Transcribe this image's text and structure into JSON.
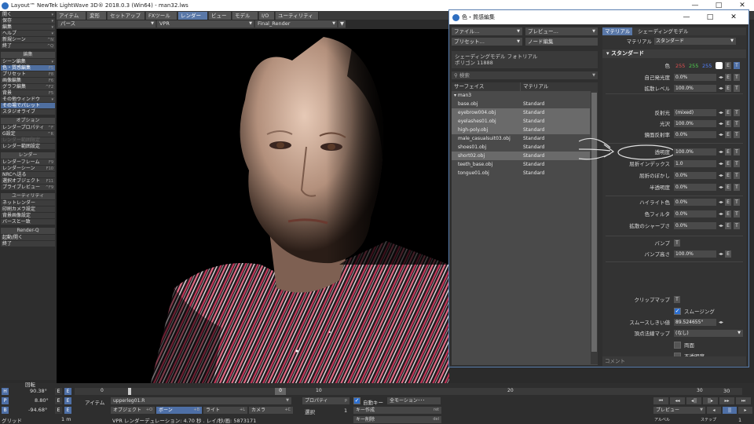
{
  "window": {
    "title": "Layout™ NewTek LightWave 3D® 2018.0.3 (Win64) - man32.lws",
    "controls": [
      "—",
      "□",
      "✕"
    ]
  },
  "menu_tabs": [
    {
      "label": "ファイル",
      "active": false
    },
    {
      "label": "アイテム",
      "active": false
    },
    {
      "label": "変形",
      "active": false
    },
    {
      "label": "セットアップ",
      "active": false
    },
    {
      "label": "FXツール",
      "active": false
    },
    {
      "label": "レンダー",
      "active": true
    },
    {
      "label": "ビュー",
      "active": false
    },
    {
      "label": "モデル",
      "active": false
    },
    {
      "label": "I/O",
      "active": false
    },
    {
      "label": "ユーティリティ",
      "active": false
    }
  ],
  "viewport_toolbar": {
    "view_mode": "パース",
    "render_mode": "VPR",
    "camera": "Final_Render"
  },
  "left_panel": {
    "groups": [
      {
        "items": [
          {
            "label": "開く",
            "shortcut": "▾"
          },
          {
            "label": "保存",
            "shortcut": "▾"
          },
          {
            "label": "編集",
            "shortcut": "▾"
          },
          {
            "label": "ヘルプ",
            "shortcut": "▾"
          },
          {
            "label": "新規シーン",
            "shortcut": "^N"
          },
          {
            "label": "終了",
            "shortcut": "^Q"
          }
        ]
      },
      {
        "header": "編集",
        "items": [
          {
            "label": "シーン編集",
            "shortcut": "▾"
          },
          {
            "label": "色・質感編集",
            "shortcut": "F5",
            "highlight": true
          },
          {
            "label": "プリセット",
            "shortcut": "F8"
          },
          {
            "label": "画像編集",
            "shortcut": "F6"
          },
          {
            "label": "グラフ編集",
            "shortcut": "^F2"
          },
          {
            "label": "背景",
            "shortcut": "F5"
          },
          {
            "label": "その他ウィンドウ",
            "shortcut": "▾"
          },
          {
            "label": "その場でパレット",
            "highlight": true
          },
          {
            "label": "スタジオライブ"
          }
        ]
      },
      {
        "header": "オプション",
        "items": [
          {
            "label": "レンダープロパティ",
            "shortcut": "^F"
          },
          {
            "label": "G設定",
            "shortcut": "^R"
          },
          {
            "label": "レンダー範囲限定",
            "dim": true
          },
          {
            "label": "レンダー範囲設定"
          }
        ]
      },
      {
        "header": "レンダー",
        "items": [
          {
            "label": "レンダーフレーム",
            "shortcut": "F9"
          },
          {
            "label": "レンダーシーン",
            "shortcut": "F10"
          },
          {
            "label": "NRCへ送る"
          },
          {
            "label": "選択オブジェクト",
            "shortcut": "F11"
          },
          {
            "label": "プライプレビュー",
            "shortcut": "^F9"
          }
        ]
      },
      {
        "header": "ユーティリティ",
        "items": [
          {
            "label": "ネットレンダー"
          },
          {
            "label": "印刷カメラ設定"
          },
          {
            "label": "背景画像設定"
          },
          {
            "label": "バースと一致"
          }
        ]
      },
      {
        "header": "Render-Q",
        "items": [
          {
            "label": "起動/開く"
          },
          {
            "label": "終了"
          }
        ]
      }
    ]
  },
  "material_editor": {
    "title": "色・質感編集",
    "controls": [
      "—",
      "□",
      "✕"
    ],
    "file_menu": "ファイル…",
    "preview_menu": "プレビュー…",
    "preset_menu": "プリセット…",
    "node_edit": "ノード編集",
    "shading_model_label": "シェーディングモデル フォトリアル",
    "polygon_label": "ポリゴン",
    "polygon_count": "11888",
    "search_placeholder": "検索",
    "table": {
      "col_surface": "サーフェイス",
      "col_material": "マテリアル",
      "root": "▾ man3",
      "rows": [
        {
          "surface": "base.obj",
          "material": "Standard",
          "selected": false
        },
        {
          "surface": "eyebrow004.obj",
          "material": "Standard",
          "selected": true
        },
        {
          "surface": "eyelashes01.obj",
          "material": "Standard",
          "selected": true
        },
        {
          "surface": "high-poly.obj",
          "material": "Standard",
          "selected": true
        },
        {
          "surface": "male_casualsuit03.obj",
          "material": "Standard",
          "selected": false
        },
        {
          "surface": "shoes01.obj",
          "material": "Standard",
          "selected": false
        },
        {
          "surface": "short02.obj",
          "material": "Standard",
          "selected": true
        },
        {
          "surface": "teeth_base.obj",
          "material": "Standard",
          "selected": false
        },
        {
          "surface": "tongue01.obj",
          "material": "Standard",
          "selected": false
        }
      ]
    },
    "tabs": [
      {
        "label": "マテリアル",
        "active": true
      },
      {
        "label": "シェーディングモデル",
        "active": false
      }
    ],
    "material_type_label": "マテリアル",
    "material_type": "スタンダード",
    "section": "▾ スタンダード",
    "color": {
      "label": "色",
      "r": "255",
      "g": "255",
      "b": "255",
      "r_color": "#e05050",
      "g_color": "#50d050",
      "b_color": "#5080ff"
    },
    "props_a": [
      {
        "label": "自己発光度",
        "value": "0.0%"
      },
      {
        "label": "拡散レベル",
        "value": "100.0%"
      }
    ],
    "props_b": [
      {
        "label": "反射光",
        "value": "(mixed)"
      },
      {
        "label": "光沢",
        "value": "100.0%"
      },
      {
        "label": "鏡面反射率",
        "value": "0.0%"
      }
    ],
    "props_c": [
      {
        "label": "透明度",
        "value": "100.0%"
      },
      {
        "label": "屈折インデックス",
        "value": "1.0"
      },
      {
        "label": "屈折のぼかし",
        "value": "0.0%"
      },
      {
        "label": "半透明度",
        "value": "0.0%"
      }
    ],
    "props_d": [
      {
        "label": "ハイライト色",
        "value": "0.0%"
      },
      {
        "label": "色フィルタ",
        "value": "0.0%"
      },
      {
        "label": "拡散のシャープさ",
        "value": "0.0%"
      }
    ],
    "bump": {
      "label": "バンプ",
      "t": "T"
    },
    "bump_height": {
      "label": "バンプ高さ",
      "value": "100.0%"
    },
    "clip_map": {
      "label": "クリップマップ",
      "t": "T"
    },
    "smoothing": {
      "label": "スムージング",
      "checked": true
    },
    "smoothing_threshold": {
      "label": "スムースしきい値",
      "value": "89.524655°"
    },
    "vertex_normal_map": {
      "label": "頂点法線マップ",
      "value": "(なし)"
    },
    "double_sided": {
      "label": "両面",
      "checked": false
    },
    "opaque": {
      "label": "不透明度",
      "checked": false
    },
    "comment_label": "コメント",
    "e_label": "E",
    "t_label": "T",
    "spin": "◂▸"
  },
  "bottom": {
    "rotation_label": "回転",
    "h": {
      "label": "H",
      "value": "90.38°"
    },
    "p": {
      "label": "P",
      "value": "8.80°"
    },
    "b": {
      "label": "B",
      "value": "-94.68°"
    },
    "grid_label": "グリッド",
    "grid_value": "1 m",
    "timeline_ticks": [
      "0",
      "10",
      "20",
      "30"
    ],
    "current_frame_box": "0",
    "end_frame": "30",
    "item_label": "アイテム",
    "item_value": "upperleg01.R",
    "object_label": "オブジェクト",
    "object_sc": "+O",
    "bone_label": "ボーン",
    "bone_sc": "+B",
    "light_label": "ライト",
    "light_sc": "+L",
    "camera_label": "カメラ",
    "camera_sc": "+C",
    "property_label": "プロパティ",
    "property_sc": "p",
    "select_label": "選択",
    "select_count": "1",
    "autokey_label": "自動キー",
    "autokey_mode": "全モーション･･･",
    "create_key": "キー作成",
    "create_key_sc": "ret",
    "delete_key": "キー削除",
    "delete_key_sc": "del",
    "status": "VPR レンダーデュレーション: 4.70 秒 . レイ/秒/画: 5873171",
    "preview_label": "プレビュー",
    "step_label": "ステップ",
    "step_value": "1",
    "anim_label": "アルベル",
    "transport": [
      "⏮",
      "◂◂",
      "◂||",
      "||▸",
      "▸▸",
      "⏭"
    ],
    "play": [
      "◂",
      "||",
      "▸"
    ],
    "x_label": "X",
    "y_label": "Y",
    "z_label": "Z",
    "e_label": "E"
  }
}
